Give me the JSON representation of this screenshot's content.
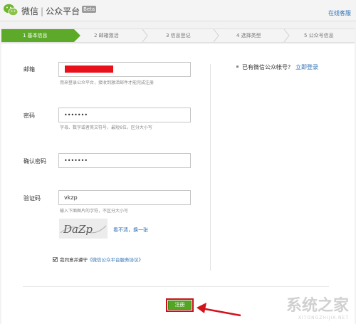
{
  "header": {
    "brand_left": "微信",
    "brand_right": "公众平台",
    "beta": "Beta",
    "help_link": "在线客服"
  },
  "steps": [
    {
      "label": "1 基本信息",
      "active": true
    },
    {
      "label": "2 邮箱激活",
      "active": false
    },
    {
      "label": "3 信息登记",
      "active": false
    },
    {
      "label": "4 选择类型",
      "active": false
    },
    {
      "label": "5 公众号信息",
      "active": false
    }
  ],
  "form": {
    "email": {
      "label": "邮箱",
      "value": "",
      "hint": "用来登录公众平台，接收到激活邮件才能完成注册"
    },
    "password": {
      "label": "密码",
      "value": "•••••••",
      "hint": "字母、数字或者英文符号，最短6位，区分大小写"
    },
    "confirm_password": {
      "label": "确认密码",
      "value": "•••••••"
    },
    "captcha": {
      "label": "验证码",
      "value": "vkzp",
      "hint": "输入下面图片的字符，不区分大小写",
      "image_text": "DaZp",
      "refresh_text": "看不清，换一张"
    },
    "agreement": {
      "text": "我同意并遵守",
      "link": "《微信公众平台服务协议》",
      "checked": true
    },
    "register_button": "注册"
  },
  "sidebar": {
    "question": "已有微信公众帐号？",
    "login_link": "立即登录"
  },
  "watermark": {
    "text": "系统之家",
    "url": "XITONGZHIJIA.NET"
  },
  "colors": {
    "accent_green": "#5daa2b",
    "link_blue": "#2b6fb6",
    "highlight_red": "#c8121a"
  }
}
